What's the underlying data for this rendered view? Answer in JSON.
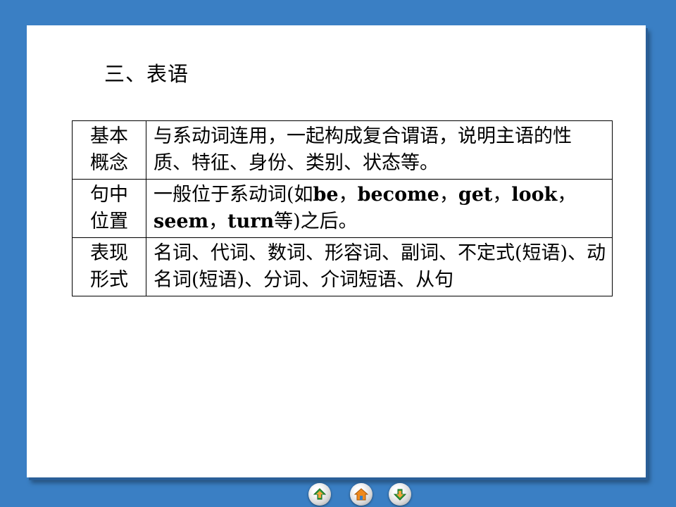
{
  "heading": "三、表语",
  "rows": [
    {
      "key_lines": [
        "基本",
        "概念"
      ],
      "value": "与系动词连用，一起构成复合谓语，说明主语的性质、特征、身份、类别、状态等。"
    },
    {
      "key_lines": [
        "句中",
        "位置"
      ],
      "value_html_parts": [
        "一般位于系动词(如",
        "be",
        "，",
        "become",
        "，",
        "get",
        "，",
        "look",
        "，",
        "seem",
        "，",
        "turn",
        "等)之后。"
      ]
    },
    {
      "key_lines": [
        "表现",
        "形式"
      ],
      "value": "名词、代词、数词、形容词、副词、不定式(短语)、动名词(短语)、分词、介词短语、从句"
    }
  ],
  "nav": {
    "prev_icon": "arrow-up-icon",
    "home_icon": "home-icon",
    "next_icon": "arrow-down-icon"
  },
  "colors": {
    "background": "#3a7fc4",
    "slide": "#ffffff",
    "nav_arrow_green": "#2e9b3a",
    "nav_arrow_orange": "#f08a1c"
  }
}
